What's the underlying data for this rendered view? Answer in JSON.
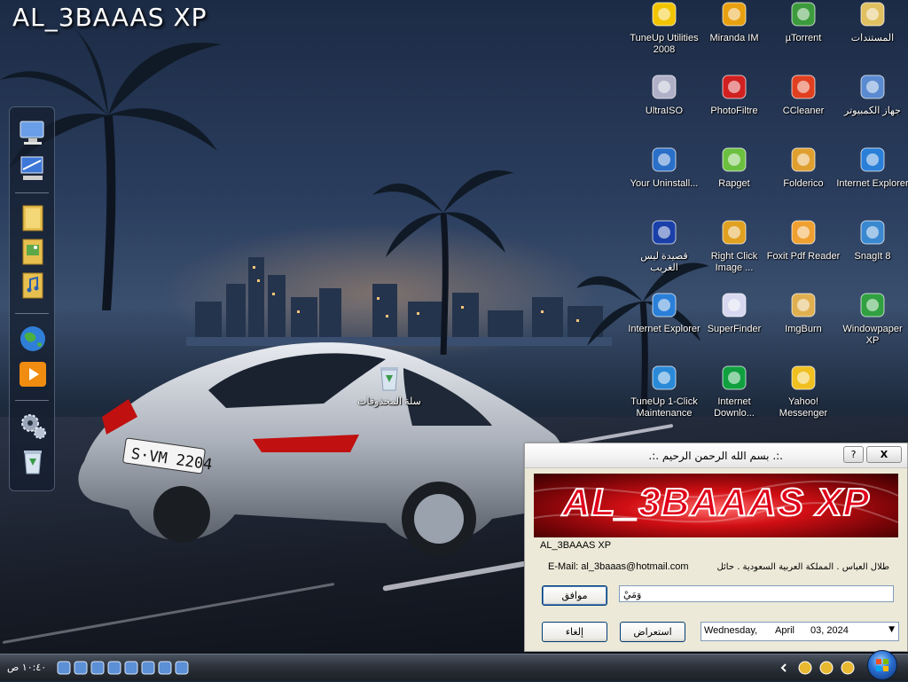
{
  "wallpaper": {
    "title": "AL_3BAAAS XP"
  },
  "dock": {
    "items": [
      {
        "icon": "computer-icon"
      },
      {
        "icon": "network-icon"
      },
      {
        "icon": "folder-icon"
      },
      {
        "icon": "pictures-folder-icon"
      },
      {
        "icon": "music-folder-icon"
      },
      {
        "icon": "globe-icon"
      },
      {
        "icon": "media-player-icon"
      },
      {
        "icon": "settings-gears-icon"
      },
      {
        "icon": "recycle-bin-icon"
      }
    ]
  },
  "desktop": {
    "recycle_bin": {
      "label": "سلة المحذوفات",
      "icon": "recycle-bin-icon"
    },
    "icons": [
      {
        "label": "TuneUp Utilities 2008",
        "icon": "tuneup-icon",
        "color": "#f2c400"
      },
      {
        "label": "Miranda IM",
        "icon": "miranda-icon",
        "color": "#e8a010"
      },
      {
        "label": "µTorrent",
        "icon": "utorrent-icon",
        "color": "#3c9b3c"
      },
      {
        "label": "المستندات",
        "icon": "documents-folder-icon",
        "color": "#e0c060"
      },
      {
        "label": "UltraISO",
        "icon": "ultraiso-icon",
        "color": "#b0b0c8"
      },
      {
        "label": "PhotoFiltre",
        "icon": "photofiltre-icon",
        "color": "#d02020"
      },
      {
        "label": "CCleaner",
        "icon": "ccleaner-icon",
        "color": "#e04020"
      },
      {
        "label": "جهاز الكمبيوتر",
        "icon": "my-computer-icon",
        "color": "#5a8ad0"
      },
      {
        "label": "Your Uninstall...",
        "icon": "your-uninstaller-icon",
        "color": "#2a6fc8"
      },
      {
        "label": "Rapget",
        "icon": "rapget-icon",
        "color": "#6cc040"
      },
      {
        "label": "Folderico",
        "icon": "folderico-icon",
        "color": "#e0a030"
      },
      {
        "label": "Internet Explorer",
        "icon": "internet-explorer-icon",
        "color": "#2a7fd8"
      },
      {
        "label": "قصيدة ليس الغريب",
        "icon": "realplayer-icon",
        "color": "#1a3fa8"
      },
      {
        "label": "Right Click Image ...",
        "icon": "right-click-image-icon",
        "color": "#e0a020"
      },
      {
        "label": "Foxit Pdf Reader",
        "icon": "foxit-icon",
        "color": "#f0a030"
      },
      {
        "label": "SnagIt 8",
        "icon": "snagit-icon",
        "color": "#3a88d0"
      },
      {
        "label": "Internet Explorer",
        "icon": "internet-explorer-icon",
        "color": "#2a7fd8"
      },
      {
        "label": "SuperFinder",
        "icon": "superfinder-icon",
        "color": "#d8d8f0"
      },
      {
        "label": "ImgBurn",
        "icon": "imgburn-icon",
        "color": "#e0b050"
      },
      {
        "label": "Windowpaper XP",
        "icon": "windowpaper-icon",
        "color": "#30a040"
      },
      {
        "label": "TuneUp 1-Click Maintenance",
        "icon": "tuneup-oneclick-icon",
        "color": "#2a8ad8"
      },
      {
        "label": "Internet Downlo...",
        "icon": "internet-download-icon",
        "color": "#10a040"
      },
      {
        "label": "Yahoo! Messenger",
        "icon": "yahoo-messenger-icon",
        "color": "#f0c020"
      }
    ]
  },
  "dialog": {
    "title": ".:.  بسم الله الرحمن الرحيم  .:.",
    "help_label": "?",
    "close_label": "X",
    "banner_text": "AL_3BAAAS XP",
    "product_name": "AL_3BAAAS XP",
    "email": "E-Mail: al_3baaas@hotmail.com",
    "author": "طلال العباس . المملكة العربية السعودية . حائل",
    "ok_label": "موافق",
    "input_value": "وَمَيْ",
    "cancel_label": "إلغاء",
    "browse_label": "استعراض",
    "date": {
      "weekday": "Wednesday,",
      "month": "April",
      "day_year": "03, 2024"
    }
  },
  "taskbar": {
    "clock": "١٠:٤٠ ص",
    "quick_launch": [
      "show-desktop-icon",
      "wand-icon",
      "folder-small-icon",
      "ie-small-icon",
      "camera-icon",
      "globe-small-icon",
      "media-small-icon",
      "play-icon"
    ],
    "tray": [
      "chevron-icon",
      "yahoo-tray-icon",
      "network-tray-icon",
      "monitor-tray-icon"
    ]
  },
  "colors": {
    "accent": "#0b2f6e",
    "dialog_bg": "#ece9d8",
    "banner_red": "#d10f14"
  }
}
